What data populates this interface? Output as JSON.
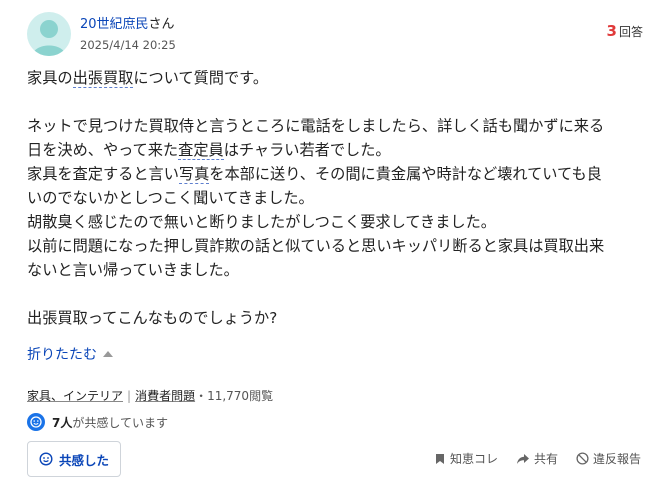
{
  "user": {
    "name": "20世紀庶民",
    "suffix": "さん",
    "date": "2025/4/14 20:25"
  },
  "answers": {
    "count": "3",
    "label": "回答"
  },
  "question": {
    "title_pre": "家具の",
    "title_kw": "出張買取",
    "title_post": "について質問です。",
    "l1": "ネットで見つけた買取侍と言うところに電話をしましたら、詳しく話も聞かずに来る",
    "l2_pre": "日を決め、やって来た",
    "l2_kw": "査定員",
    "l2_post": "はチャラい若者でした。",
    "l3_pre": "家具を査定すると言い",
    "l3_kw": "写真",
    "l3_post": "を本部に送り、その間に貴金属や時計など壊れていても良",
    "l4": "いのでないかとしつこく聞いてきました。",
    "l5": "胡散臭く感じたので無いと断りましたがしつこく要求してきました。",
    "l6": "以前に問題になった押し買詐欺の話と似ていると思いキッパリ断ると家具は買取出来",
    "l7": "ないと言い帰っていきました。",
    "l8": "出張買取ってこんなものでしょうか?"
  },
  "fold_label": "折りたたむ",
  "meta": {
    "category1": "家具、インテリア",
    "separator": "|",
    "category2": "消費者問題",
    "views": "・11,770閲覧"
  },
  "empathy": {
    "count": "7人",
    "text": "が共感しています",
    "button_label": "共感した"
  },
  "actions": {
    "bookmark": "知恵コレ",
    "share": "共有",
    "report": "違反報告"
  },
  "colors": {
    "link": "#0b46b8",
    "accent_red": "#e03a3a",
    "avatar_bg": "#cfeeed"
  }
}
